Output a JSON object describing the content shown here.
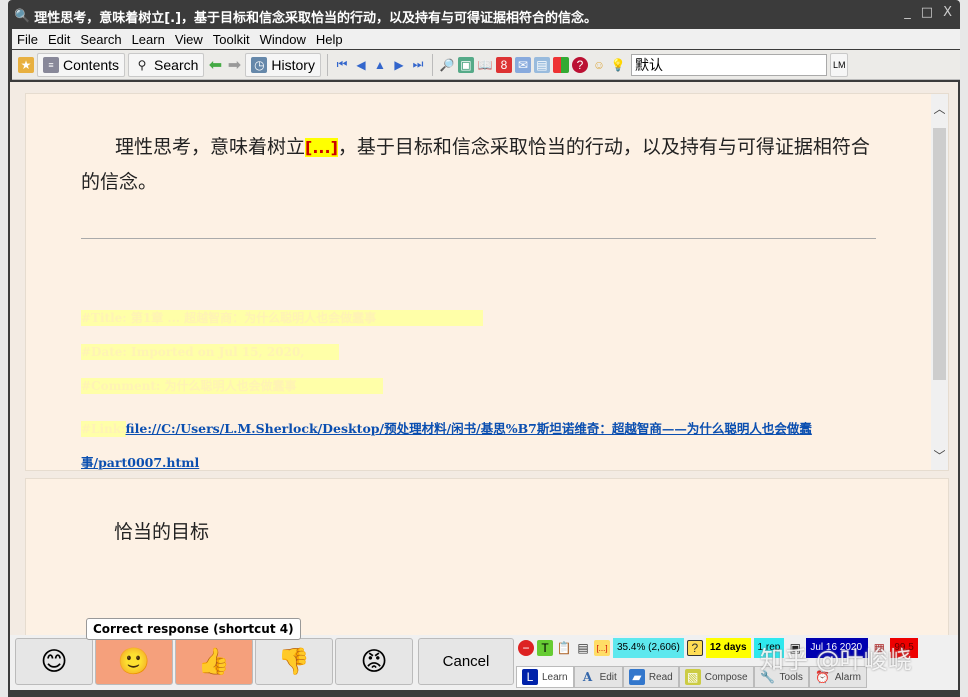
{
  "window": {
    "title": "理性思考，意味着树立[.]，基于目标和信念采取恰当的行动，以及持有与可得证据相符合的信念。",
    "controls": [
      "_",
      "□",
      "X"
    ]
  },
  "menu": [
    "File",
    "Edit",
    "Search",
    "Learn",
    "View",
    "Toolkit",
    "Window",
    "Help"
  ],
  "toolbar": {
    "contents": "Contents",
    "search": "Search",
    "history": "History",
    "concept": "默认",
    "right_stub": "LM"
  },
  "element1": {
    "question_before": "理性思考，意味着树立",
    "cloze": "[...]",
    "question_after": "，基于目标和信念采取恰当的行动，以及持有与可得证据相符合的信念。",
    "ref_title": "#Title: 第1章 ... 超越智商：为什么聪明人也会做蠢事",
    "ref_date": "#Date: Imported on Jul 15, 2020, 00:13:55",
    "ref_comment": "#Comment: 为什么聪明人也会做蠢事",
    "ref_link_label": "#Link: ",
    "link": "file://C:/Users/L.M.Sherlock/Desktop/预处理材料/闲书/基思%B7斯坦诺维奇：超越智商——为什么聪明人也会做蠢事/part0007.html"
  },
  "element2": {
    "answer": "恰当的目标"
  },
  "grades": {
    "tooltip": "Correct response (shortcut 4)",
    "cancel": "Cancel"
  },
  "status": {
    "progress": "35.4%",
    "count": "(2,606)",
    "interval": "12 days",
    "reps": "1 rep",
    "date": "Jul 16 2020",
    "priority": "99.5"
  },
  "tabs": [
    "Learn",
    "Edit",
    "Read",
    "Compose",
    "Tools",
    "Alarm"
  ],
  "watermark": "知乎 @叶峻峣"
}
